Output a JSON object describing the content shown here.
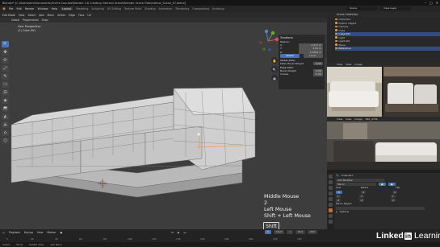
{
  "window": {
    "title": "Blender* [C:\\Users\\ster\\Documents\\Online Courses\\Blender 2.8 Creating Interiors Scene\\Blender Scene Files\\Interior_Scene_07.blend]",
    "controls": [
      "–",
      "□",
      "✕"
    ]
  },
  "menubar": {
    "menus": [
      "File",
      "Edit",
      "Render",
      "Window",
      "Help"
    ],
    "workspaces": [
      "Layout",
      "Modeling",
      "Sculpting",
      "UV Editing",
      "Texture Paint",
      "Shading",
      "Animation",
      "Rendering",
      "Compositing",
      "Scripting"
    ],
    "active_workspace": "Layout",
    "scene": "Scene",
    "view_layer": "View Layer"
  },
  "viewport": {
    "header": [
      "Edit Mode",
      "View",
      "Select",
      "Add",
      "Mesh",
      "Vertex",
      "Edge",
      "Face",
      "UV"
    ],
    "header2": [
      "Global",
      "Proportional",
      "Snap"
    ],
    "info_line1": "User Perspective",
    "info_line2": "(1) Cube.001",
    "tools": [
      "⇱",
      "✥",
      "⟳",
      "⤢",
      "✎",
      "▭",
      "⊡",
      "◈",
      "⬒",
      "◭",
      "⟁",
      "⌂",
      "⬡"
    ],
    "nav_buttons": [
      "✋",
      "🔍",
      "▦"
    ]
  },
  "npanel": {
    "header": "Transform",
    "median": "Median:",
    "rows": [
      {
        "label": "X:",
        "value": "-2.217 m"
      },
      {
        "label": "Y:",
        "value": "4.82 m"
      },
      {
        "label": "Z:",
        "value": "0.7809 m"
      }
    ],
    "global_label": "Global",
    "local_label": "Local",
    "vertex_data": "Vertex Data:",
    "mean_bevel_label": "Mean Bevel Weight",
    "mean_bevel_value": "0.00",
    "edge_data": "Edge Data:",
    "bevel_label": "Bevel Weight",
    "bevel_value": "0.00",
    "crease_label": "Crease",
    "crease_value": "0.00"
  },
  "overlay_keys": {
    "line1": "Middle Mouse",
    "line2": "2",
    "line3": "Left Mouse",
    "line4": "Shift + Left Mouse",
    "key": "Shift"
  },
  "outliner": {
    "header": "Scene Collection",
    "items": [
      "Collection",
      "Interior Object",
      "Camera",
      "Cube",
      "Cube.001",
      "Light",
      "Light.001",
      "Plane",
      "Reference"
    ]
  },
  "image_editor": {
    "header": [
      "View",
      "View",
      "Image"
    ],
    "header2": [
      "View",
      "View",
      "Image",
      "IMG_4756"
    ]
  },
  "properties": {
    "object": "Cube.001",
    "modifier_label": "Add Modifier",
    "mirror_label": "Mirror",
    "axis": "Axis",
    "bisect": "Bisect",
    "flip": "Flip",
    "x": "X",
    "y": "Y",
    "z": "Z",
    "mirror_object": "Mirror Object",
    "options": "Options"
  },
  "timeline": {
    "header": [
      "Playback",
      "Keying",
      "View",
      "Marker"
    ],
    "frame_current": "1",
    "start_label": "Start",
    "start": "1",
    "end_label": "End",
    "end": "250",
    "ticks": [
      "0",
      "20",
      "40",
      "60",
      "80",
      "100",
      "120",
      "140",
      "160",
      "180",
      "200",
      "220",
      "240"
    ]
  },
  "status": [
    "Select",
    "Move",
    "Rotate View",
    "Call Menu"
  ],
  "logo": {
    "part1": "Linked",
    "part2": "in",
    "part3": "Learning"
  },
  "colors": {
    "accent_blue": "#4772b3",
    "viewport_bg": "#3d3d3d",
    "selection_orange": "#e09b4a"
  }
}
